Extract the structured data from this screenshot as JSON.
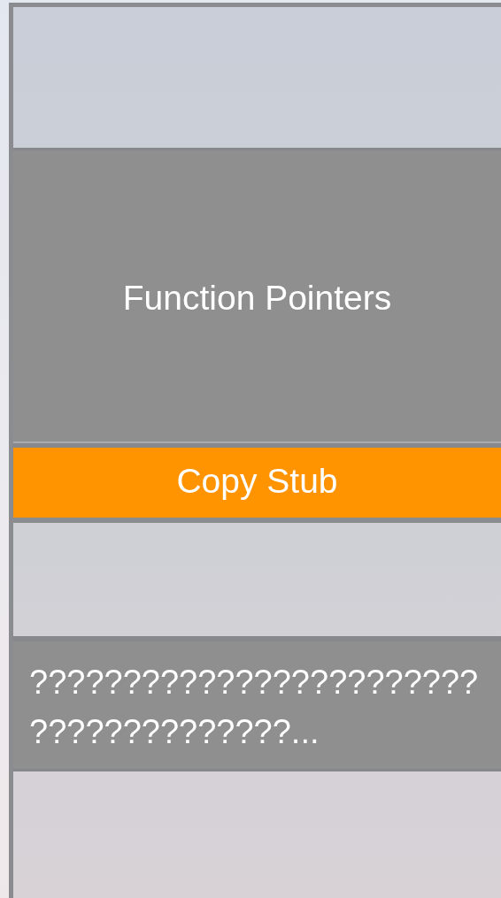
{
  "title_panel": {
    "title": "Function Pointers"
  },
  "copy_button": {
    "label": "Copy Stub"
  },
  "description_panel": {
    "text": "??????????????????????????????????????..."
  }
}
